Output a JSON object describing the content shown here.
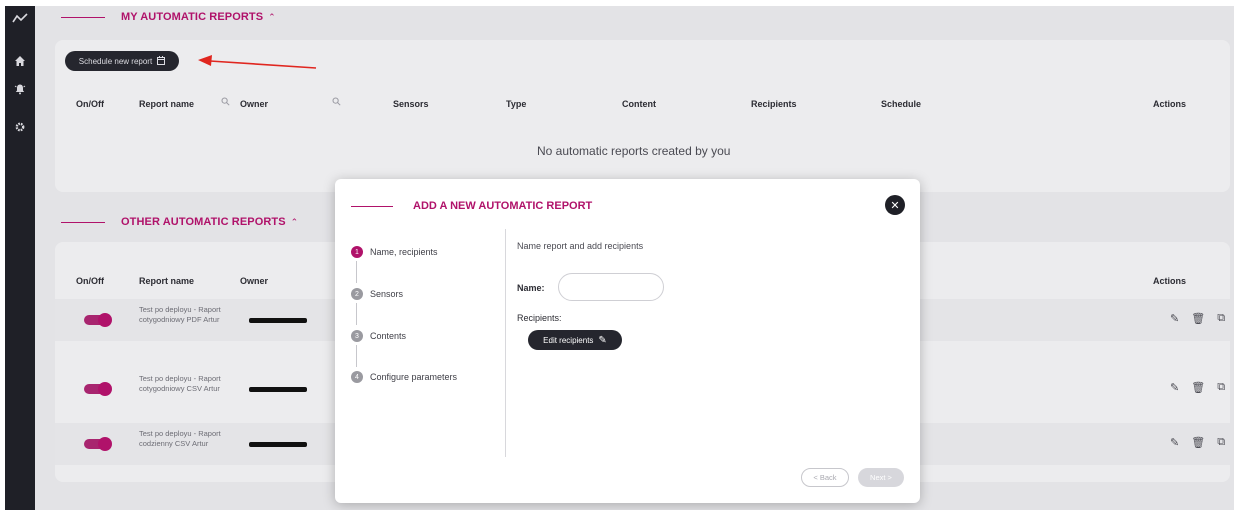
{
  "colors": {
    "accent": "#b0126a",
    "sidebar": "#1f2027",
    "dark_button": "#25262e"
  },
  "sidebar": {
    "icons": [
      "chart-line-icon",
      "home-icon",
      "alarm-bell-icon",
      "gear-icon"
    ]
  },
  "my_reports": {
    "title": "MY AUTOMATIC REPORTS",
    "schedule_button": "Schedule new report",
    "columns": [
      "On/Off",
      "Report name",
      "Owner",
      "Sensors",
      "Type",
      "Content",
      "Recipients",
      "Schedule",
      "Actions"
    ],
    "empty_message": "No automatic reports created by you"
  },
  "other_reports": {
    "title": "OTHER AUTOMATIC REPORTS",
    "columns": [
      "On/Off",
      "Report name",
      "Owner",
      "Actions"
    ],
    "rows": [
      {
        "name": "Test po deployu - Raport cotygodniowy PDF Artur",
        "enabled": true
      },
      {
        "name": "Test po deployu - Raport cotygodniowy CSV Artur",
        "enabled": true
      },
      {
        "name": "Test po deployu - Raport codzienny CSV Artur",
        "enabled": true
      }
    ]
  },
  "modal": {
    "title": "ADD A NEW AUTOMATIC REPORT",
    "steps": [
      {
        "num": "1",
        "label": "Name, recipients",
        "active": true
      },
      {
        "num": "2",
        "label": "Sensors",
        "active": false
      },
      {
        "num": "3",
        "label": "Contents",
        "active": false
      },
      {
        "num": "4",
        "label": "Configure parameters",
        "active": false
      }
    ],
    "subtitle": "Name report and add recipients",
    "name_label": "Name:",
    "name_value": "",
    "recipients_label": "Recipients:",
    "edit_recipients_button": "Edit recipients",
    "back_button": "< Back",
    "next_button": "Next >"
  }
}
